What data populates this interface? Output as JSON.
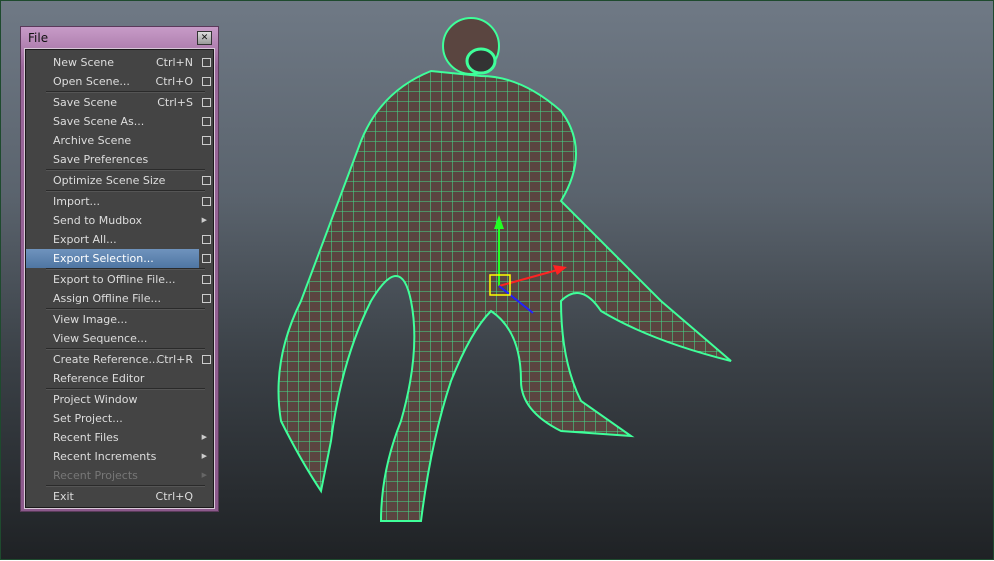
{
  "menu": {
    "title": "File",
    "close_icon": "close-icon",
    "groups": [
      [
        {
          "label": "New Scene",
          "shortcut": "Ctrl+N",
          "option": true
        },
        {
          "label": "Open Scene...",
          "shortcut": "Ctrl+O",
          "option": true
        }
      ],
      [
        {
          "label": "Save Scene",
          "shortcut": "Ctrl+S",
          "option": true
        },
        {
          "label": "Save Scene As...",
          "option": true
        },
        {
          "label": "Archive Scene",
          "option": true
        },
        {
          "label": "Save Preferences"
        }
      ],
      [
        {
          "label": "Optimize Scene Size",
          "option": true
        }
      ],
      [
        {
          "label": "Import...",
          "option": true
        },
        {
          "label": "Send to Mudbox",
          "submenu": true
        },
        {
          "label": "Export All...",
          "option": true
        },
        {
          "label": "Export Selection...",
          "option": true,
          "selected": true
        }
      ],
      [
        {
          "label": "Export to Offline File...",
          "option": true
        },
        {
          "label": "Assign Offline File...",
          "option": true
        }
      ],
      [
        {
          "label": "View Image..."
        },
        {
          "label": "View Sequence..."
        }
      ],
      [
        {
          "label": "Create Reference...",
          "shortcut": "Ctrl+R",
          "option": true
        },
        {
          "label": "Reference Editor"
        }
      ],
      [
        {
          "label": "Project Window"
        },
        {
          "label": "Set Project..."
        },
        {
          "label": "Recent Files",
          "submenu": true
        },
        {
          "label": "Recent Increments",
          "submenu": true
        },
        {
          "label": "Recent Projects",
          "submenu": true,
          "disabled": true
        }
      ],
      [
        {
          "label": "Exit",
          "shortcut": "Ctrl+Q"
        }
      ]
    ]
  },
  "colors": {
    "wireframe": "#3fff9a",
    "selected": "#5a80ad"
  }
}
